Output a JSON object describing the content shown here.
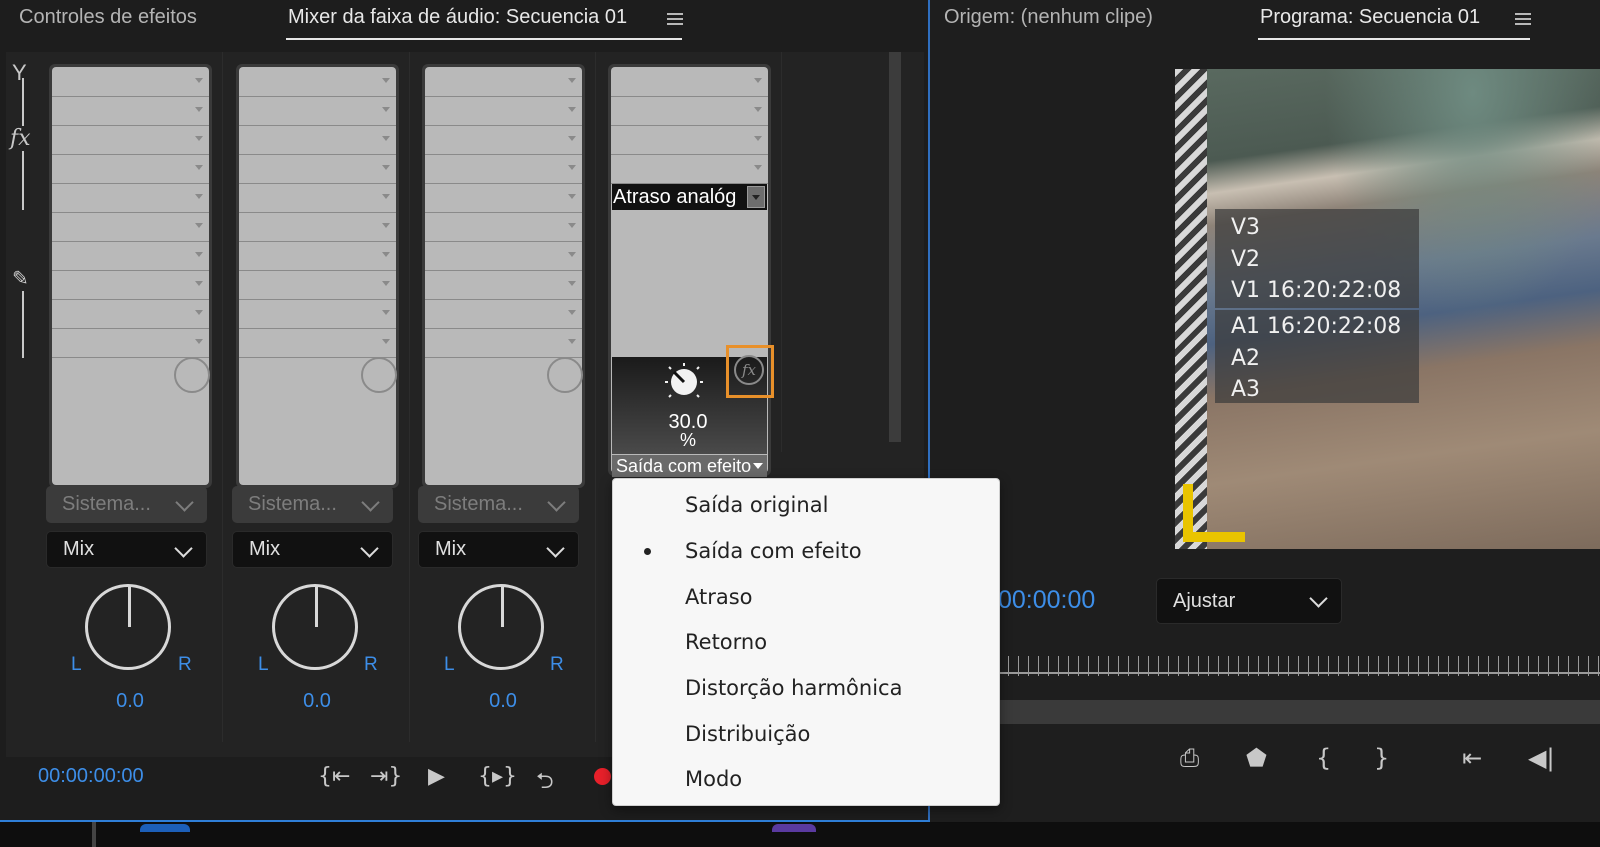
{
  "left_panel": {
    "tabs": [
      {
        "label": "Controles de efeitos",
        "active": false
      },
      {
        "label": "Mixer da faixa de áudio: Secuencia 01",
        "active": true
      }
    ]
  },
  "rack_icons": [
    "send-icon",
    "fx-icon",
    "automation-icon"
  ],
  "strips": [
    {
      "output_label": "Sistema...",
      "mode_label": "Mix",
      "pan_left": "L",
      "pan_right": "R",
      "pan_value": "0.0"
    },
    {
      "output_label": "Sistema...",
      "mode_label": "Mix",
      "pan_left": "L",
      "pan_right": "R",
      "pan_value": "0.0"
    },
    {
      "output_label": "Sistema...",
      "mode_label": "Mix",
      "pan_left": "L",
      "pan_right": "R",
      "pan_value": "0.0"
    }
  ],
  "effect_strip": {
    "effect_name": "Atraso analóg",
    "param_value": "30.0",
    "param_unit": "%",
    "param_selector": "Saída com efeito"
  },
  "transport": {
    "timecode": "00:00:00:00",
    "buttons": [
      "go-to-in-icon",
      "go-to-out-icon",
      "play-icon",
      "play-in-to-out-icon",
      "loop-icon",
      "record-icon"
    ]
  },
  "right_panel": {
    "tabs": [
      {
        "label": "Origem: (nenhum clipe)",
        "active": false
      },
      {
        "label": "Programa: Secuencia 01",
        "active": true
      }
    ],
    "overlay_video": [
      "V3",
      "V2",
      "V1 16:20:22:08"
    ],
    "overlay_audio": [
      "A1 16:20:22:08",
      "A2",
      "A3"
    ],
    "timecode": "00:00:00",
    "fit_label": "Ajustar",
    "buttons": [
      "export-frame-icon",
      "marker-icon",
      "mark-in-icon",
      "mark-out-icon",
      "go-to-in-icon",
      "step-back-icon"
    ]
  },
  "context_menu": {
    "items": [
      {
        "label": "Saída original",
        "selected": false
      },
      {
        "label": "Saída com efeito",
        "selected": true
      },
      {
        "label": "Atraso",
        "selected": false
      },
      {
        "label": "Retorno",
        "selected": false
      },
      {
        "label": "Distorção harmônica",
        "selected": false
      },
      {
        "label": "Distribuição",
        "selected": false
      },
      {
        "label": "Modo",
        "selected": false
      }
    ]
  },
  "colors": {
    "accent": "#3d8ee8",
    "highlight": "#e8902a",
    "record": "#e8202a",
    "safe_margin": "#e9c400"
  }
}
